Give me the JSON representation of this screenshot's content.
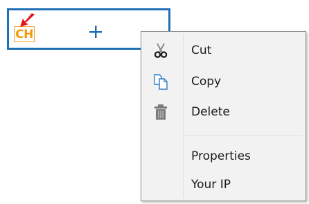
{
  "item": {
    "badge_text": "CH",
    "badge_color": "#f29a0c",
    "border_color": "#1f6fb5",
    "arrow_color": "#e3121b",
    "badge_icon": "arrow-icon",
    "add_icon": "plus-icon"
  },
  "context_menu": {
    "items": [
      {
        "label": "Cut",
        "icon": "scissors-icon"
      },
      {
        "label": "Copy",
        "icon": "copy-icon"
      },
      {
        "label": "Delete",
        "icon": "trash-icon"
      },
      {
        "label": "Properties",
        "icon": ""
      },
      {
        "label": "Your IP",
        "icon": ""
      }
    ]
  }
}
